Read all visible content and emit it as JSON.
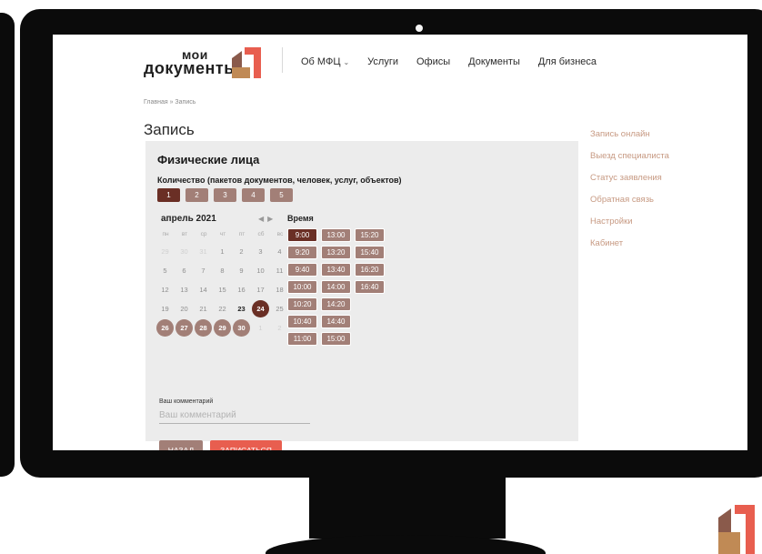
{
  "brand": {
    "logo_top": "мои",
    "logo_bottom": "документы",
    "accent": "#e85e4f",
    "dark_accent": "#6a2f25",
    "muted_accent": "#a27f77"
  },
  "nav": {
    "items": [
      {
        "label": "Об МФЦ",
        "has_caret": true
      },
      {
        "label": "Услуги"
      },
      {
        "label": "Офисы"
      },
      {
        "label": "Документы"
      },
      {
        "label": "Для бизнеса"
      }
    ]
  },
  "breadcrumb": "Главная » Запись",
  "page_title": "Запись",
  "side_menu": [
    "Запись онлайн",
    "Выезд специалиста",
    "Статус заявления",
    "Обратная связь",
    "Настройки",
    "Кабинет"
  ],
  "form": {
    "title": "Физические лица",
    "quantity_label": "Количество (пакетов документов, человек, услуг, объектов)",
    "quantity_options": [
      "1",
      "2",
      "3",
      "4",
      "5"
    ],
    "quantity_selected": "1",
    "calendar": {
      "month": "апрель 2021",
      "weekdays": [
        "пн",
        "вт",
        "ср",
        "чт",
        "пт",
        "сб",
        "вс"
      ],
      "days": [
        {
          "d": "29",
          "state": "muted"
        },
        {
          "d": "30",
          "state": "muted"
        },
        {
          "d": "31",
          "state": "muted"
        },
        {
          "d": "1",
          "state": "normal"
        },
        {
          "d": "2",
          "state": "normal"
        },
        {
          "d": "3",
          "state": "normal"
        },
        {
          "d": "4",
          "state": "normal"
        },
        {
          "d": "5",
          "state": "normal"
        },
        {
          "d": "6",
          "state": "normal"
        },
        {
          "d": "7",
          "state": "normal"
        },
        {
          "d": "8",
          "state": "normal"
        },
        {
          "d": "9",
          "state": "normal"
        },
        {
          "d": "10",
          "state": "normal"
        },
        {
          "d": "11",
          "state": "normal"
        },
        {
          "d": "12",
          "state": "normal"
        },
        {
          "d": "13",
          "state": "normal"
        },
        {
          "d": "14",
          "state": "normal"
        },
        {
          "d": "15",
          "state": "normal"
        },
        {
          "d": "16",
          "state": "normal"
        },
        {
          "d": "17",
          "state": "normal"
        },
        {
          "d": "18",
          "state": "normal"
        },
        {
          "d": "19",
          "state": "normal"
        },
        {
          "d": "20",
          "state": "normal"
        },
        {
          "d": "21",
          "state": "normal"
        },
        {
          "d": "22",
          "state": "normal"
        },
        {
          "d": "23",
          "state": "bold"
        },
        {
          "d": "24",
          "state": "selected"
        },
        {
          "d": "25",
          "state": "normal"
        },
        {
          "d": "26",
          "state": "avail"
        },
        {
          "d": "27",
          "state": "avail"
        },
        {
          "d": "28",
          "state": "avail"
        },
        {
          "d": "29",
          "state": "avail"
        },
        {
          "d": "30",
          "state": "avail"
        },
        {
          "d": "1",
          "state": "muted"
        },
        {
          "d": "2",
          "state": "muted"
        }
      ]
    },
    "time_label": "Время",
    "time_slots": [
      [
        "9:00",
        "9:20",
        "9:40",
        "10:00",
        "10:20",
        "10:40",
        "11:00"
      ],
      [
        "13:00",
        "13:20",
        "13:40",
        "14:00",
        "14:20",
        "14:40",
        "15:00"
      ],
      [
        "15:20",
        "15:40",
        "16:20",
        "16:40"
      ]
    ],
    "time_selected": "9:00",
    "comment_label": "Ваш комментарий",
    "comment_placeholder": "Ваш комментарий",
    "back_label": "НАЗАД",
    "submit_label": "ЗАПИСАТЬСЯ"
  }
}
